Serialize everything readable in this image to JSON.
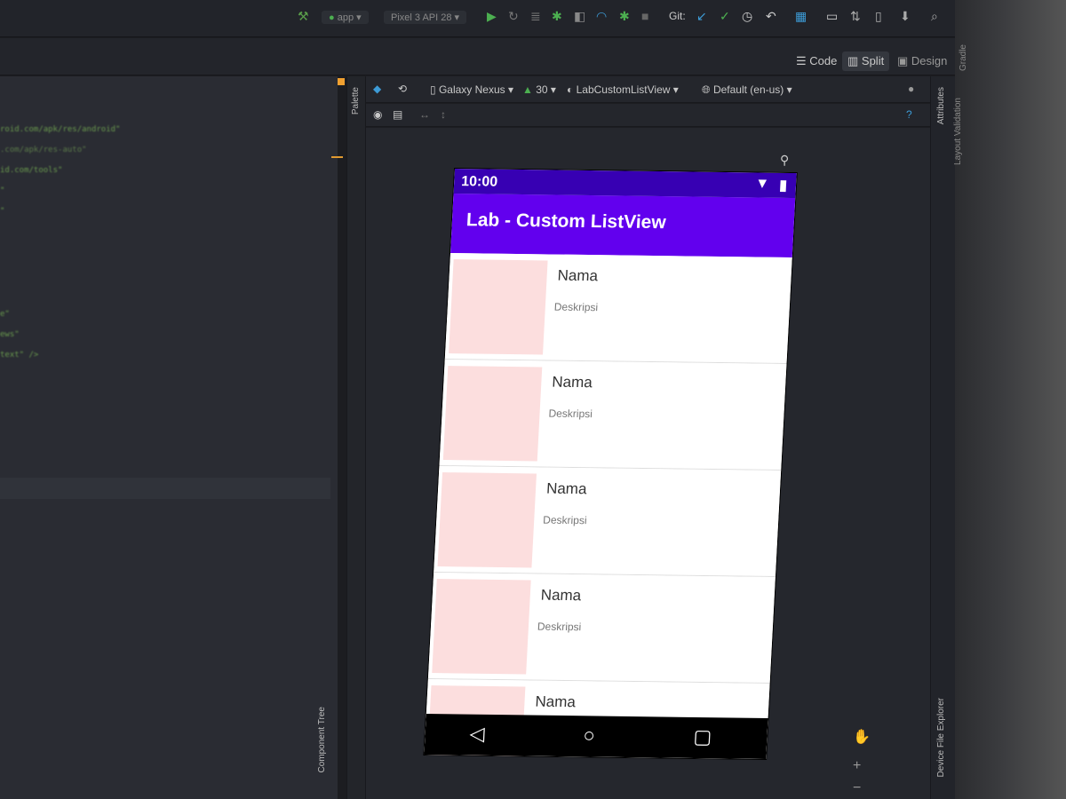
{
  "toolbar": {
    "device": "Pixel 3 API 28",
    "app": "app",
    "git_label": "Git:"
  },
  "view_modes": {
    "code": "Code",
    "split": "Split",
    "design": "Design"
  },
  "editor": {
    "lines": [
      "roid.com/apk/res/android\"",
      ".com/apk/res-auto\"",
      "id.com/tools\"",
      "\"",
      "\"",
      "e\"",
      "ews\"",
      "text\" />"
    ]
  },
  "side_panels": {
    "palette": "Palette",
    "component_tree": "Component Tree",
    "attributes": "Attributes",
    "layout_validation": "Layout Validation",
    "gradle": "Gradle",
    "device_file_explorer": "Device File Explorer"
  },
  "design_toolbar": {
    "device": "Galaxy Nexus",
    "api": "30",
    "theme": "LabCustomListView",
    "locale": "Default (en-us)"
  },
  "phone": {
    "time": "10:00",
    "app_title": "Lab - Custom ListView",
    "items": [
      {
        "name": "Nama",
        "desc": "Deskripsi"
      },
      {
        "name": "Nama",
        "desc": "Deskripsi"
      },
      {
        "name": "Nama",
        "desc": "Deskripsi"
      },
      {
        "name": "Nama",
        "desc": "Deskripsi"
      },
      {
        "name": "Nama",
        "desc": ""
      }
    ],
    "colors": {
      "status_bar": "#3700b3",
      "app_bar": "#6200ee",
      "thumbnail": "#fcdede"
    }
  }
}
